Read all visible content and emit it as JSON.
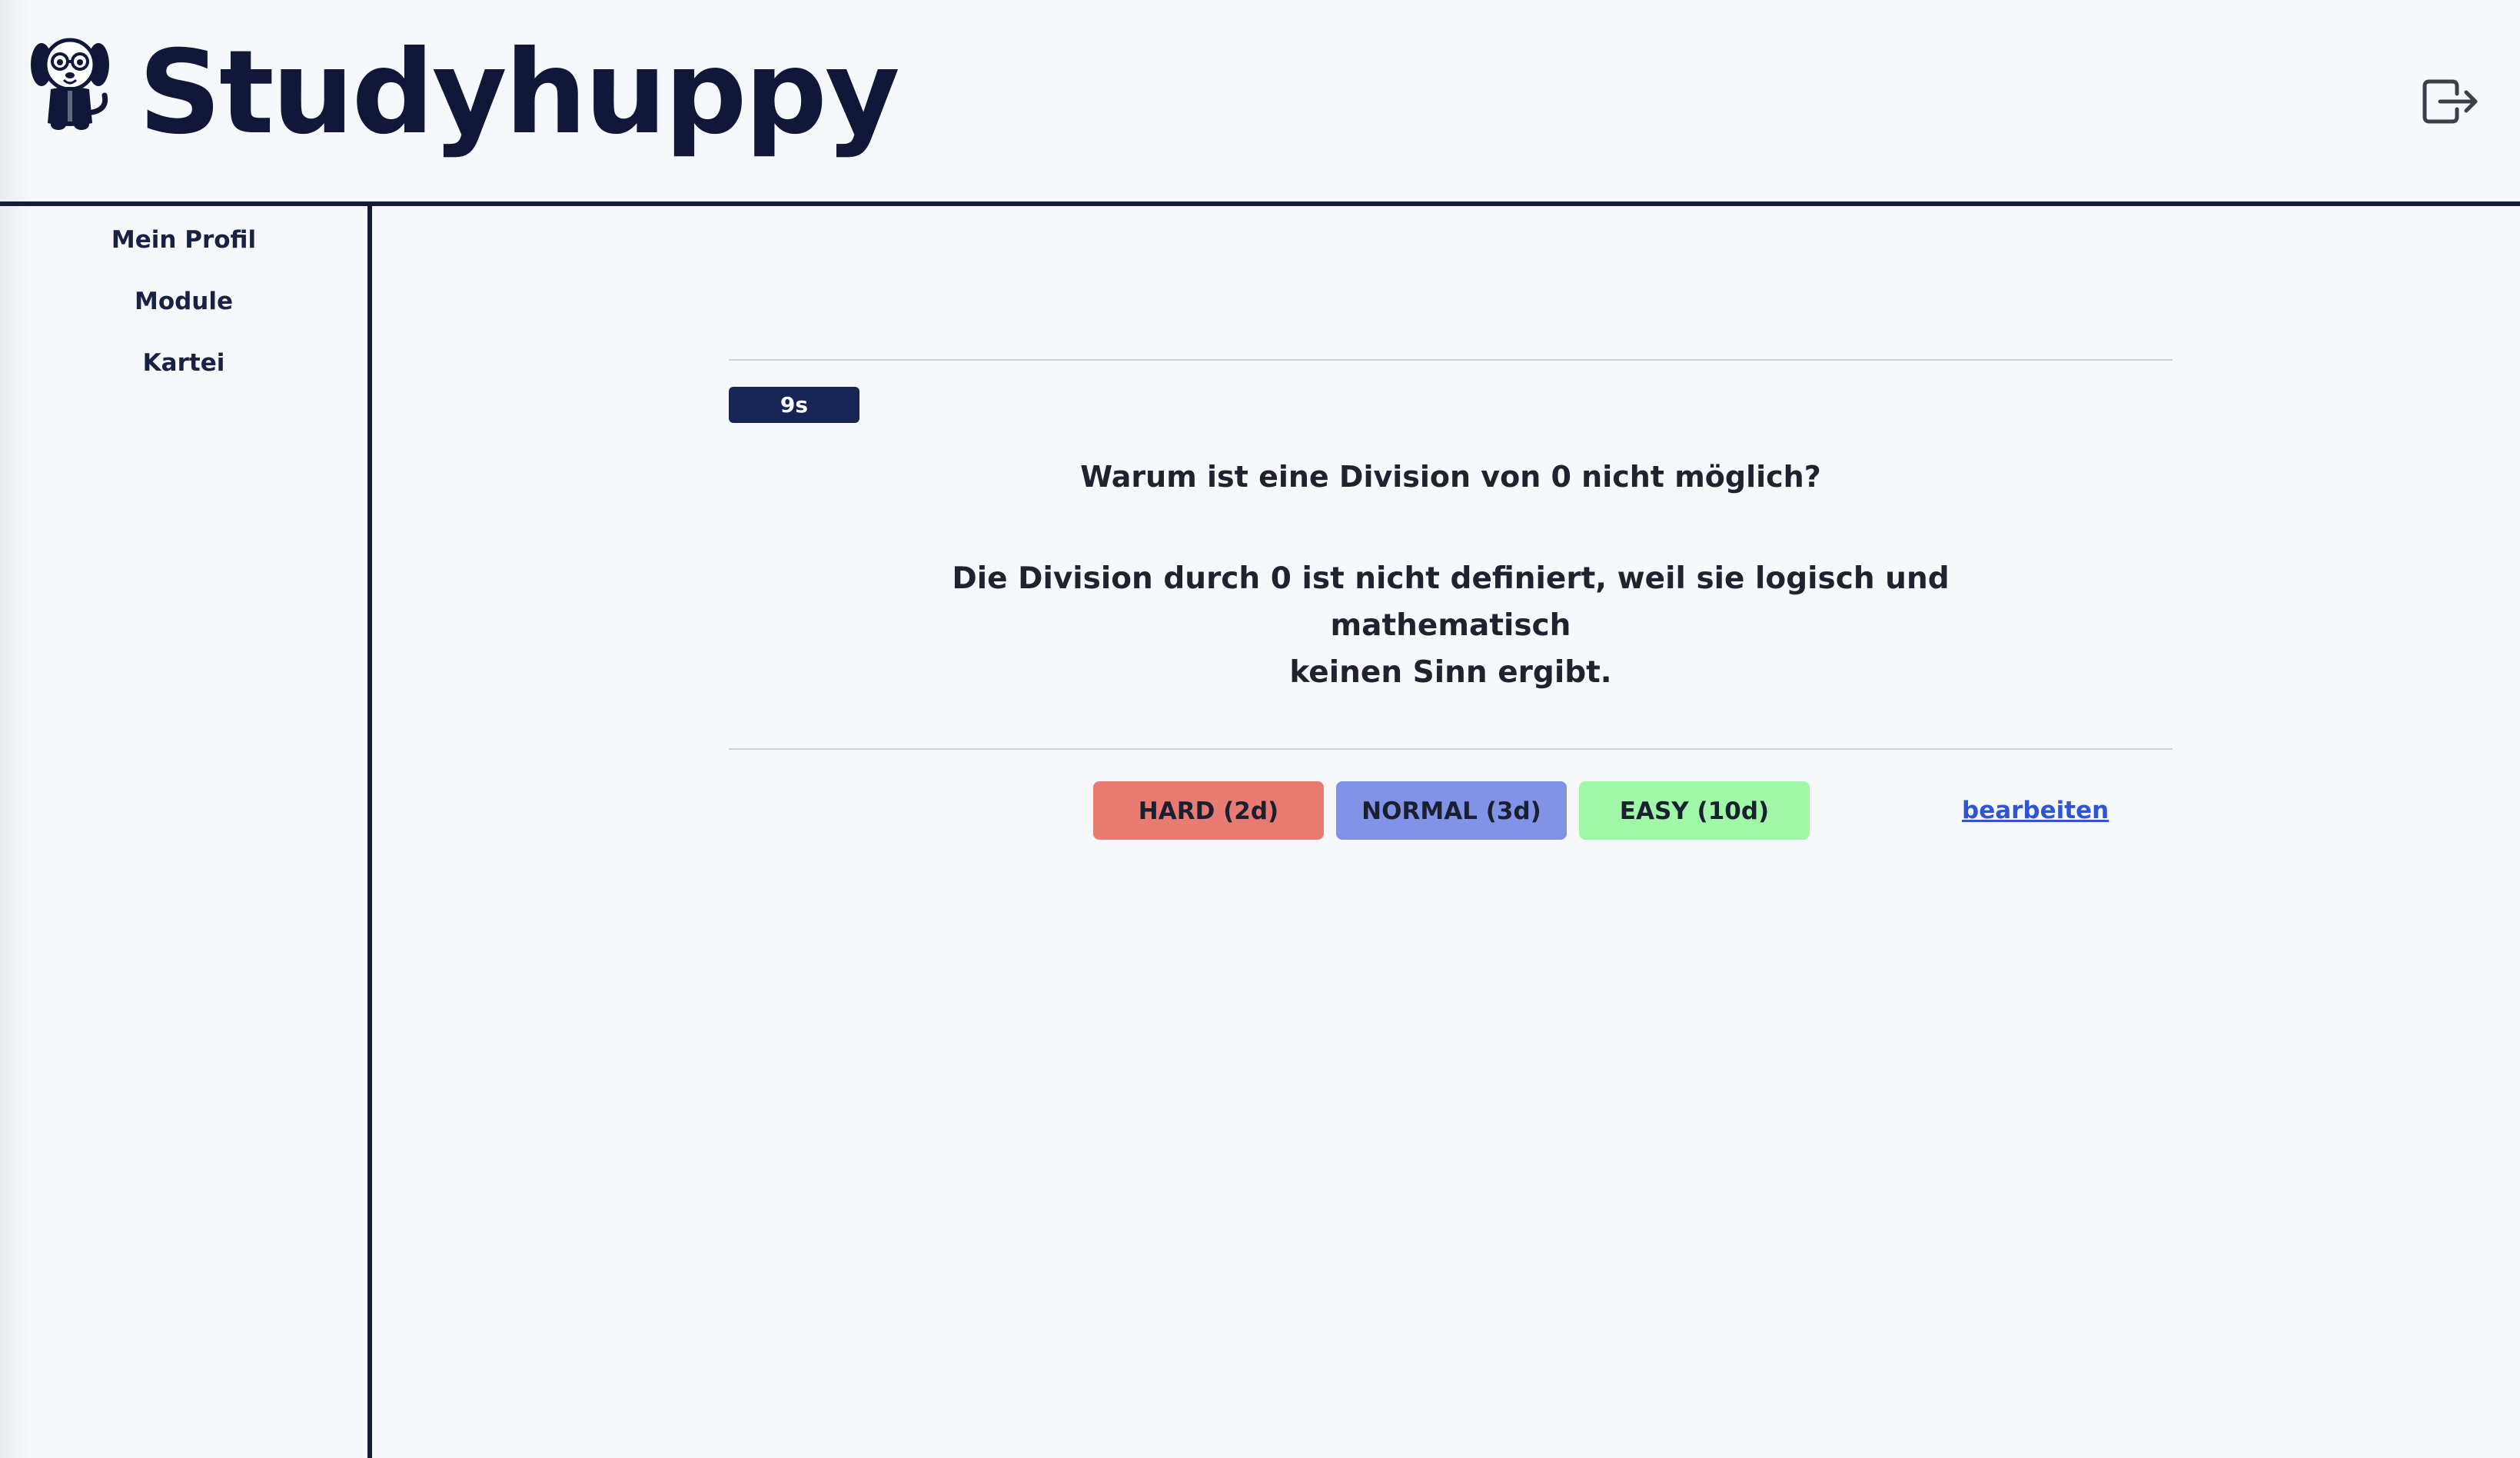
{
  "header": {
    "brand": "Studyhuppy",
    "logo_icon": "dog-mascot-icon",
    "logout_icon": "logout-icon"
  },
  "sidebar": {
    "items": [
      {
        "label": "Mein Profil"
      },
      {
        "label": "Module"
      },
      {
        "label": "Kartei"
      }
    ]
  },
  "card": {
    "timer": "9s",
    "question": "Warum ist eine Division von 0 nicht möglich?",
    "answer_line1": "Die Division durch 0 ist nicht definiert, weil sie logisch und mathematisch",
    "answer_line2": "keinen Sinn ergibt."
  },
  "actions": {
    "hard": "HARD (2d)",
    "normal": "NORMAL (3d)",
    "easy": "EASY (10d)",
    "edit": "bearbeiten"
  },
  "colors": {
    "primary": "#141c3c",
    "timer_bg": "#172554",
    "hard": "#e97c72",
    "normal": "#8093e6",
    "easy": "#a1f7a8",
    "link": "#2f55d4",
    "background": "#f6f8fb"
  }
}
